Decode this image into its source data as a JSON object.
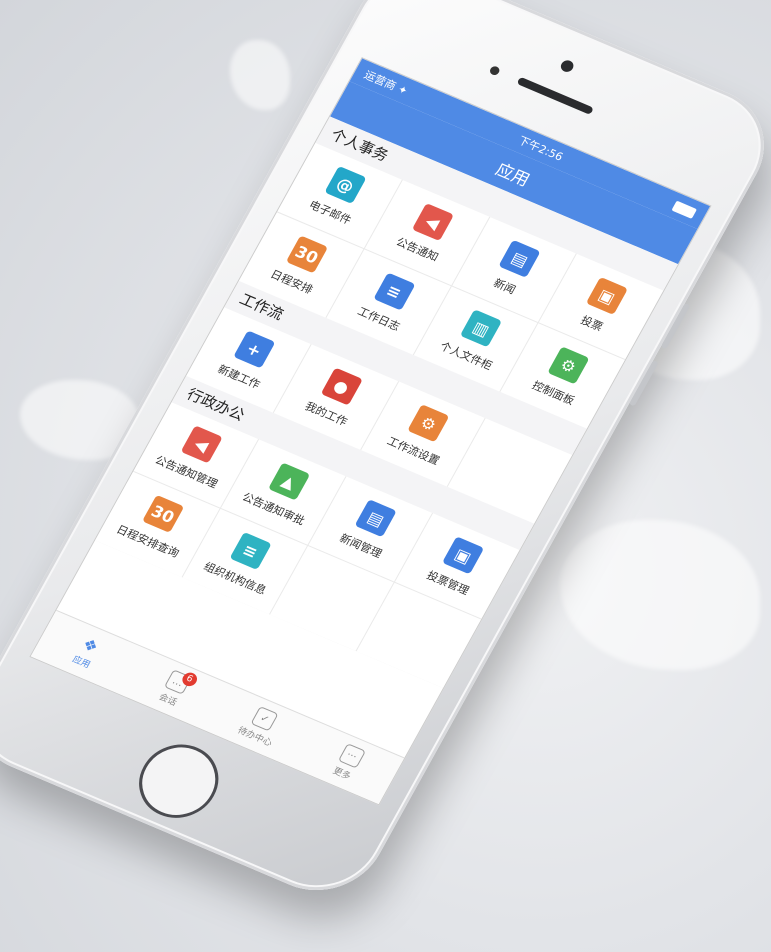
{
  "status": {
    "carrier": "运营商 ✦",
    "time": "下午2:56"
  },
  "header": {
    "title": "应用"
  },
  "sections": [
    {
      "title": "个人事务",
      "items": [
        {
          "label": "电子邮件",
          "icon": "at-icon",
          "color": "#23a7c9",
          "glyph": "@"
        },
        {
          "label": "公告通知",
          "icon": "speaker-icon",
          "color": "#e2574c",
          "glyph": "◀"
        },
        {
          "label": "新闻",
          "icon": "news-icon",
          "color": "#3f7ee0",
          "glyph": "▤"
        },
        {
          "label": "投票",
          "icon": "ballot-box-icon",
          "color": "#e8843a",
          "glyph": "▣"
        },
        {
          "label": "日程安排",
          "icon": "calendar-icon",
          "color": "#e8843a",
          "glyph": "30"
        },
        {
          "label": "工作日志",
          "icon": "notebook-icon",
          "color": "#3f7ee0",
          "glyph": "≡"
        },
        {
          "label": "个人文件柜",
          "icon": "file-cabinet-icon",
          "color": "#2fb3c2",
          "glyph": "▥"
        },
        {
          "label": "控制面板",
          "icon": "control-panel-icon",
          "color": "#4cb45a",
          "glyph": "⚙"
        }
      ]
    },
    {
      "title": "工作流",
      "items": [
        {
          "label": "新建工作",
          "icon": "new-document-icon",
          "color": "#3f7ee0",
          "glyph": "+"
        },
        {
          "label": "我的工作",
          "icon": "user-icon",
          "color": "#d9443a",
          "glyph": "●"
        },
        {
          "label": "工作流设置",
          "icon": "workflow-settings-icon",
          "color": "#e8843a",
          "glyph": "⚙"
        }
      ]
    },
    {
      "title": "行政办公",
      "items": [
        {
          "label": "公告通知管理",
          "icon": "speaker-settings-icon",
          "color": "#e2574c",
          "glyph": "◀"
        },
        {
          "label": "公告通知审批",
          "icon": "approval-stamp-icon",
          "color": "#4cb45a",
          "glyph": "▲"
        },
        {
          "label": "新闻管理",
          "icon": "news-settings-icon",
          "color": "#3f7ee0",
          "glyph": "▤"
        },
        {
          "label": "投票管理",
          "icon": "ballot-settings-icon",
          "color": "#3f7ee0",
          "glyph": "▣"
        },
        {
          "label": "日程安排查询",
          "icon": "calendar-search-icon",
          "color": "#e8843a",
          "glyph": "30"
        },
        {
          "label": "组织机构信息",
          "icon": "organization-icon",
          "color": "#2fb3c2",
          "glyph": "≡"
        }
      ]
    }
  ],
  "tabs": [
    {
      "label": "应用",
      "icon": "apps-grid-icon",
      "active": true
    },
    {
      "label": "会话",
      "icon": "chat-bubble-icon",
      "badge": "6"
    },
    {
      "label": "待办中心",
      "icon": "checkbox-icon"
    },
    {
      "label": "更多",
      "icon": "more-dots-icon"
    }
  ]
}
